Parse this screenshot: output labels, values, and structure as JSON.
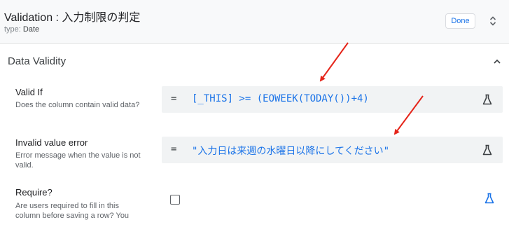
{
  "header": {
    "title": "Validation : 入力制限の判定",
    "type_label": "type:",
    "type_value": "Date",
    "done_label": "Done",
    "sort_icon": "unfold-icon"
  },
  "section": {
    "title": "Data Validity",
    "collapse_icon": "chevron-up-icon"
  },
  "fields": [
    {
      "label": "Valid If",
      "description": "Does the column contain valid data?",
      "operator": "=",
      "expression": "[_THIS] >= (EOWEEK(TODAY())+4)",
      "icon": "flask-icon"
    },
    {
      "label": "Invalid value error",
      "description": "Error message when the value is not valid.",
      "operator": "=",
      "expression": "\"入力日は来週の水曜日以降にしてください\"",
      "icon": "flask-icon"
    },
    {
      "label": "Require?",
      "description": "Are users required to fill in this column before saving a row? You",
      "checked": false,
      "icon": "flask-icon"
    }
  ],
  "colors": {
    "accent": "#1a73e8",
    "annotation_arrow": "#e5251a"
  }
}
